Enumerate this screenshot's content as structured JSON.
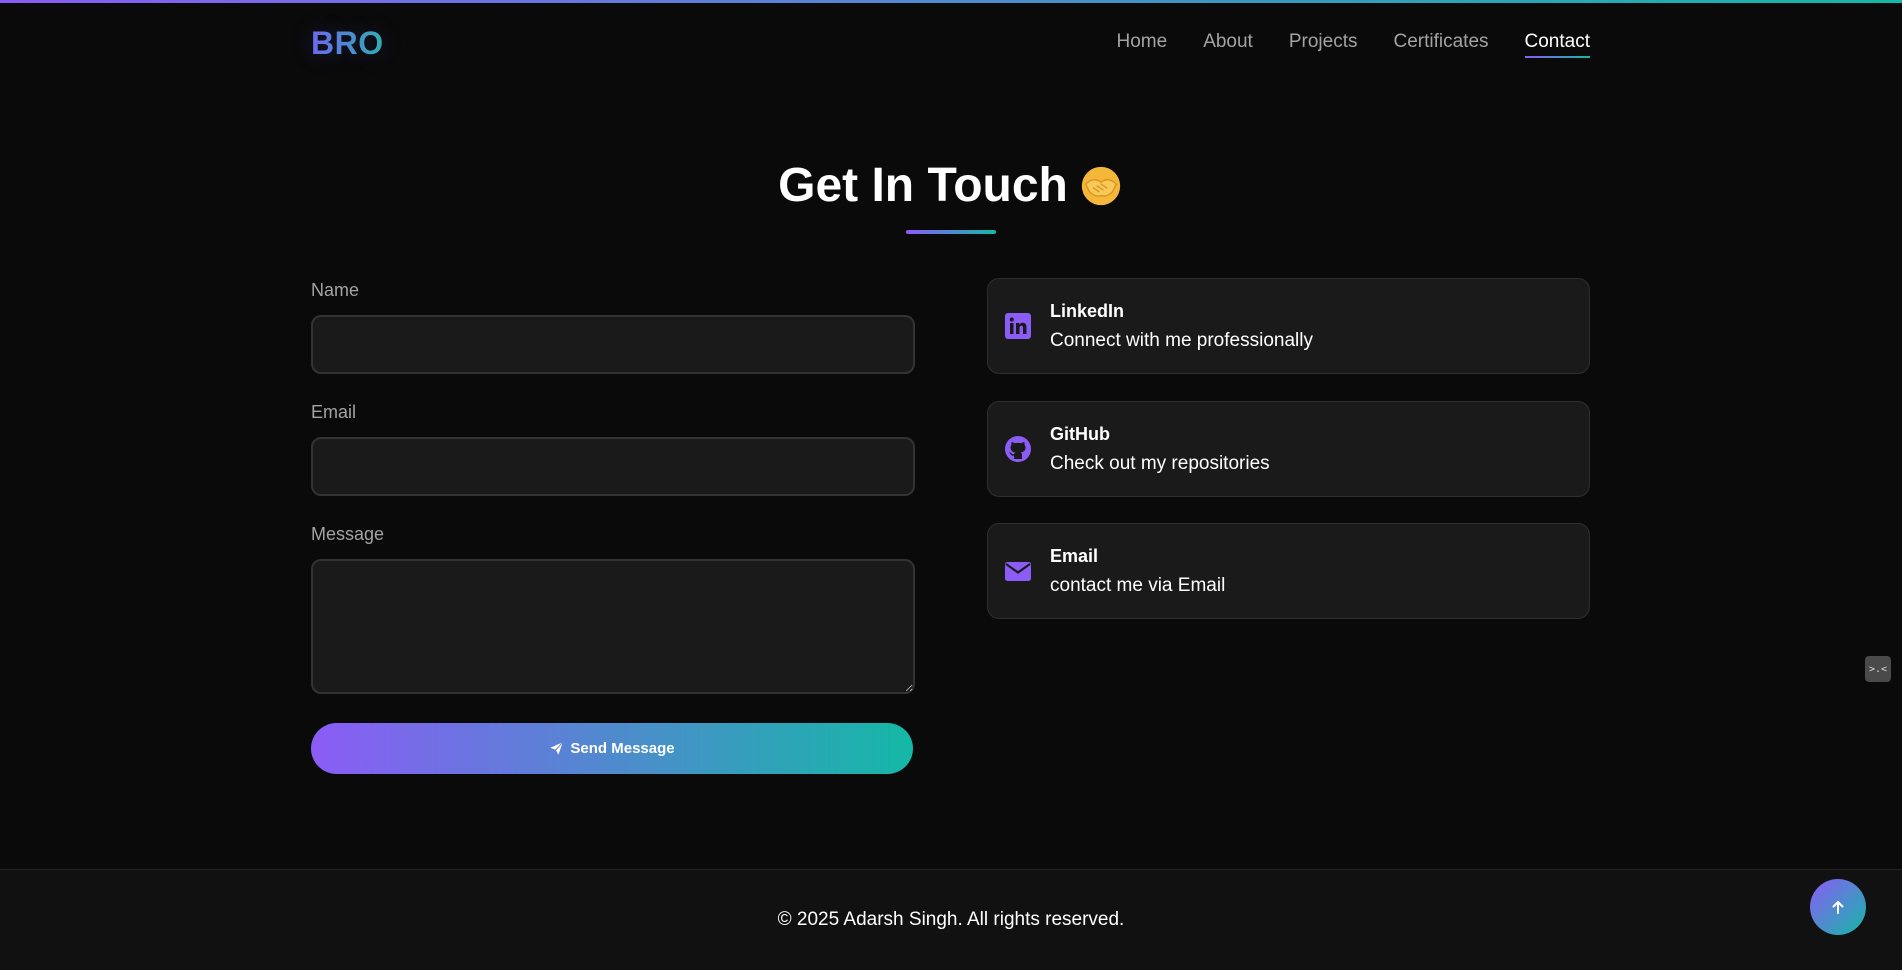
{
  "brand": {
    "logo_text": "BRO"
  },
  "nav": {
    "items": [
      {
        "label": "Home",
        "active": false
      },
      {
        "label": "About",
        "active": false
      },
      {
        "label": "Projects",
        "active": false
      },
      {
        "label": "Certificates",
        "active": false
      },
      {
        "label": "Contact",
        "active": true
      }
    ]
  },
  "section": {
    "title": "Get In Touch",
    "title_icon": "handshake-icon"
  },
  "form": {
    "name_label": "Name",
    "name_value": "",
    "email_label": "Email",
    "email_value": "",
    "message_label": "Message",
    "message_value": "",
    "submit_label": "Send Message",
    "submit_icon": "paper-plane-icon"
  },
  "contacts": [
    {
      "title": "LinkedIn",
      "description": "Connect with me professionally",
      "icon": "linkedin-icon"
    },
    {
      "title": "GitHub",
      "description": "Check out my repositories",
      "icon": "github-icon"
    },
    {
      "title": "Email",
      "description": "contact me via Email",
      "icon": "envelope-icon"
    }
  ],
  "footer": {
    "copyright": "© 2025 Adarsh Singh. All rights reserved."
  },
  "scroll_top": {
    "icon": "arrow-up-icon"
  },
  "side_widget": {
    "glyph": ">.<"
  },
  "colors": {
    "background": "#0a0a0a",
    "card": "#1a1a1a",
    "accent_purple": "#8b5cf6",
    "accent_teal": "#14b8a6",
    "icon_purple": "#8b5cf6",
    "muted_text": "#a3a3a3"
  }
}
